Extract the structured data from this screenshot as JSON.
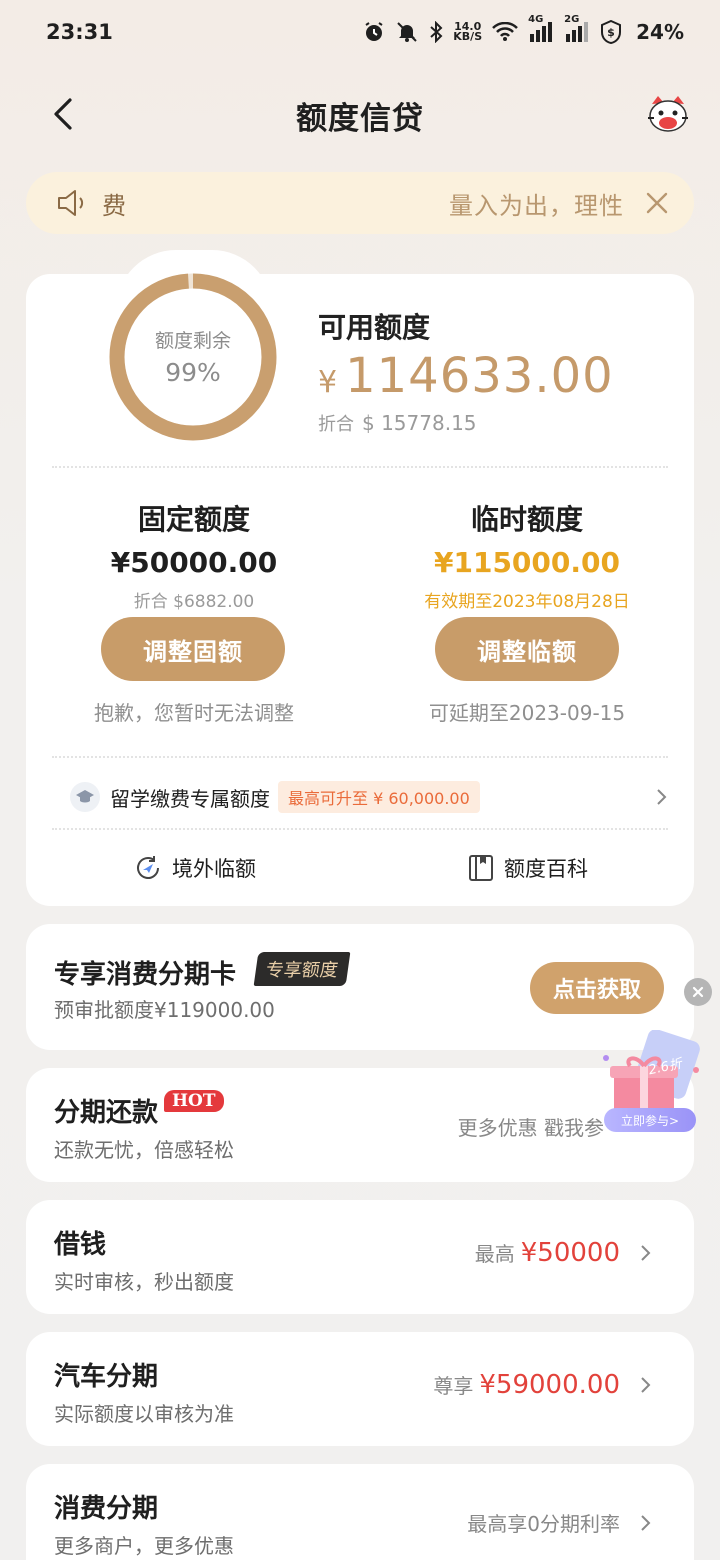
{
  "status_bar": {
    "time": "23:31",
    "net_speed_value": "14.0",
    "net_speed_unit": "KB/S",
    "signal_1": "4G",
    "signal_2": "2G",
    "battery": "24%"
  },
  "nav": {
    "title": "额度信贷",
    "back_icon": "chevron-left-icon",
    "mascot_icon": "mascot-cat-icon"
  },
  "notice": {
    "left_text": "费",
    "right_text": "量入为出，理性"
  },
  "credit": {
    "ring_label": "额度剩余",
    "ring_percent": "99%",
    "ring_fraction": 0.99,
    "available_title": "可用额度",
    "available_symbol": "¥",
    "available_amount": "114633.00",
    "convert_prefix": "折合",
    "convert_amount": "$ 15778.15"
  },
  "fixed": {
    "title": "固定额度",
    "amount": "¥50000.00",
    "convert": "折合 $6882.00",
    "button": "调整固额",
    "note": "抱歉，您暂时无法调整"
  },
  "temporary": {
    "title": "临时额度",
    "amount": "¥115000.00",
    "validity": "有效期至2023年08月28日",
    "button": "调整临额",
    "note": "可延期至2023-09-15"
  },
  "study": {
    "label": "留学缴费专属额度",
    "badge": "最高可升至 ¥ 60,000.00"
  },
  "quick_links": {
    "overseas": "境外临额",
    "wiki": "额度百科"
  },
  "installment_card": {
    "title": "专享消费分期卡",
    "badge": "专享额度",
    "subtitle": "预审批额度¥119000.00",
    "button": "点击获取"
  },
  "installment_repay": {
    "title": "分期还款",
    "badge": "HOT",
    "subtitle": "还款无忧，倍感轻松",
    "right_text": "更多优惠 戳我参"
  },
  "borrow": {
    "title": "借钱",
    "subtitle": "实时审核，秒出额度",
    "right_label": "最高",
    "right_value": "¥50000"
  },
  "car": {
    "title": "汽车分期",
    "subtitle": "实际额度以审核为准",
    "right_label": "尊享",
    "right_value": "¥59000.00"
  },
  "consumer": {
    "title": "消费分期",
    "subtitle": "更多商户，更多优惠",
    "right_text": "最高享0分期利率"
  },
  "floating_ad": {
    "badge": "2.6折",
    "button": "立即参与>"
  },
  "colors": {
    "gold": "#c59a6a",
    "orange": "#e8a520",
    "red": "#e2423b"
  }
}
